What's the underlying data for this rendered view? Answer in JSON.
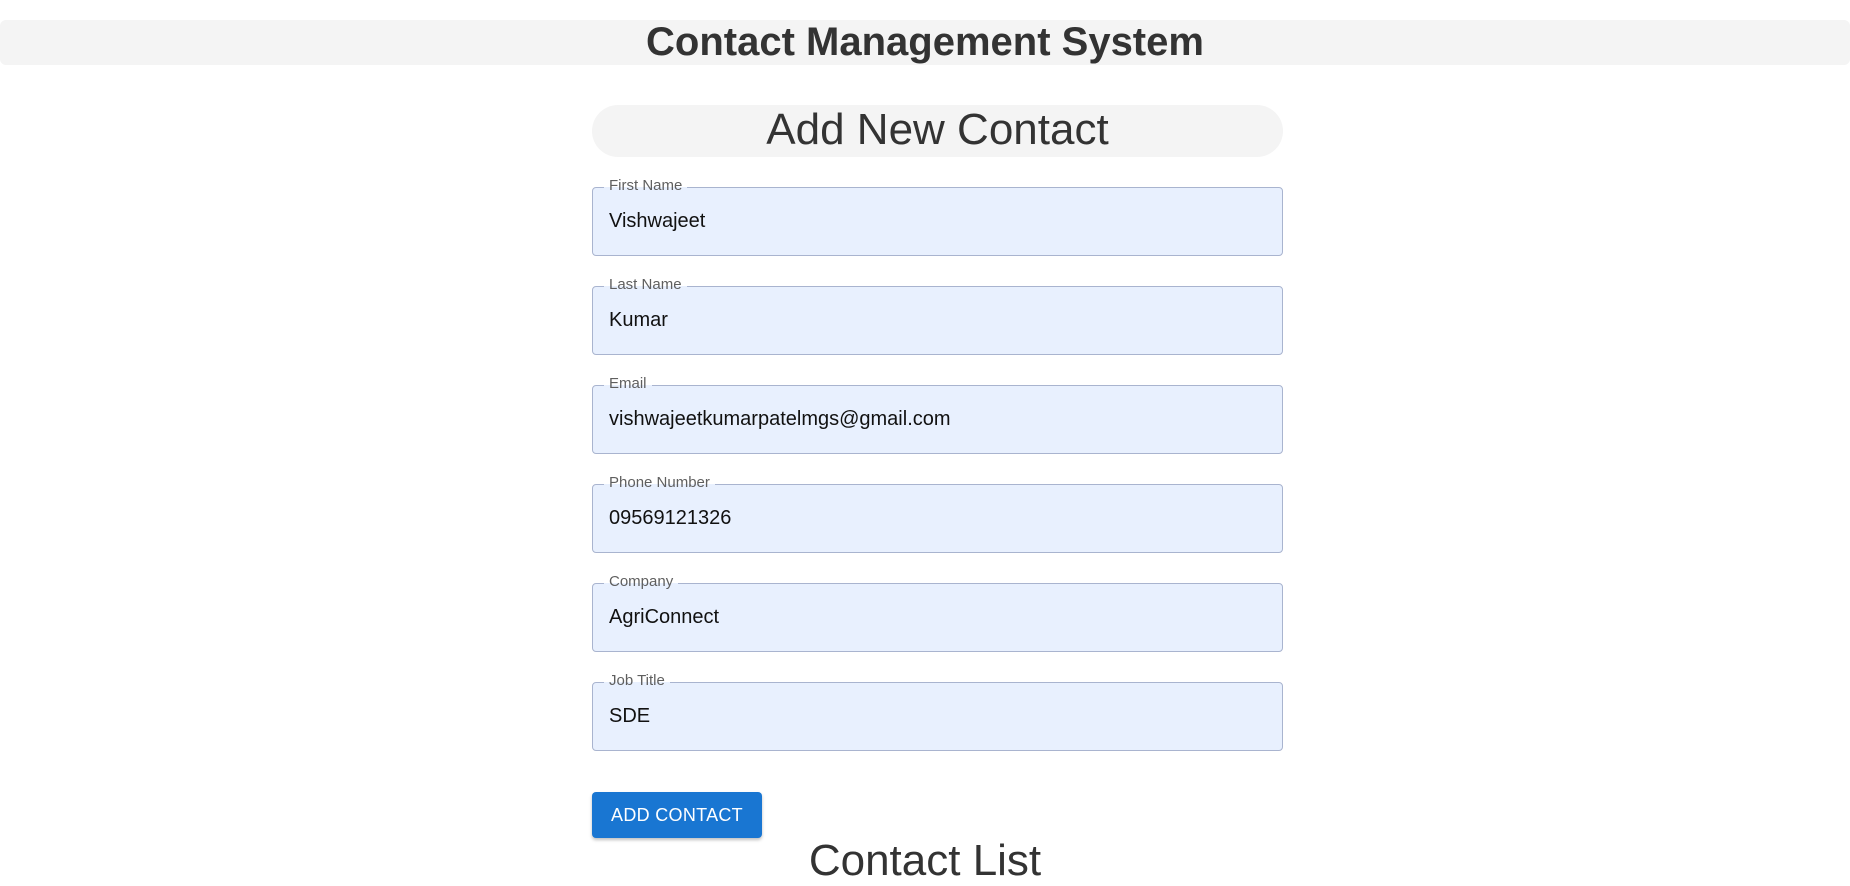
{
  "app": {
    "title": "Contact Management System"
  },
  "form": {
    "title": "Add New Contact",
    "fields": [
      {
        "label": "First Name",
        "value": "Vishwajeet"
      },
      {
        "label": "Last Name",
        "value": "Kumar"
      },
      {
        "label": "Email",
        "value": "vishwajeetkumarpatelmgs@gmail.com"
      },
      {
        "label": "Phone Number",
        "value": "09569121326"
      },
      {
        "label": "Company",
        "value": "AgriConnect"
      },
      {
        "label": "Job Title",
        "value": "SDE"
      }
    ],
    "submit_label": "ADD CONTACT"
  },
  "list": {
    "title": "Contact List"
  },
  "colors": {
    "field_background": "#e8f0fe",
    "primary_button": "#1976d2",
    "header_background": "#f4f4f4"
  }
}
